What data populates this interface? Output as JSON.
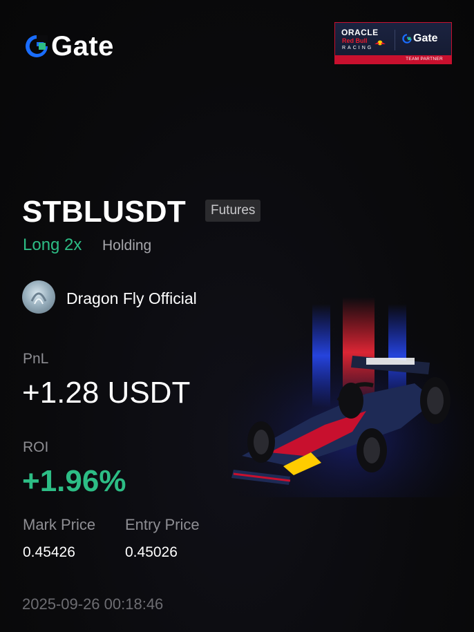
{
  "brand": {
    "logo_text": "Gate"
  },
  "partner_badge": {
    "oracle": "ORACLE",
    "red_bull": "Red Bull",
    "racing": "RACING",
    "gate": "Gate",
    "strip": "TEAM PARTNER"
  },
  "position": {
    "symbol": "STBLUSDT",
    "tag": "Futures",
    "side": "Long 2x",
    "status": "Holding"
  },
  "user": {
    "name": "Dragon Fly Official"
  },
  "pnl": {
    "label": "PnL",
    "value": "+1.28 USDT"
  },
  "roi": {
    "label": "ROI",
    "value": "+1.96%"
  },
  "prices": {
    "mark_label": "Mark Price",
    "mark_value": "0.45426",
    "entry_label": "Entry Price",
    "entry_value": "0.45026"
  },
  "timestamp": "2025-09-26 00:18:46",
  "colors": {
    "background": "#0b0b0d",
    "positive": "#2dbd85",
    "muted": "#8e8e93",
    "brand_blue": "#1a6dff",
    "brand_green": "#2dbd85",
    "partner_red": "#c8102e",
    "partner_navy": "#1b2340"
  },
  "images": {
    "car": "f1-race-car-illustration"
  }
}
